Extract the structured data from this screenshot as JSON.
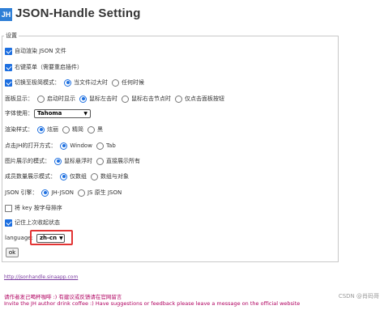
{
  "header": {
    "logo": "JH",
    "title": "JSON-Handle Setting"
  },
  "settings": {
    "legend": "设置",
    "auto_render": {
      "label": "自动渲染 JSON 文件",
      "checked": true
    },
    "context_menu": {
      "label": "右键菜单（需要重启插件）",
      "checked": true
    },
    "switch_mode": {
      "label": "切换至极简模式：",
      "checked": true,
      "options": [
        "当文件过大时",
        "任何时候"
      ],
      "selected": 0
    },
    "panel_display": {
      "label": "面板显示：",
      "options": [
        "启动时显示",
        "鼠标左击时",
        "鼠标右击节点时",
        "仅点击面板按钮"
      ],
      "selected": 1
    },
    "font": {
      "label": "字体使用：",
      "value": "Tahoma"
    },
    "render_style": {
      "label": "渲染样式：",
      "options": [
        "炫丽",
        "精简",
        "黑"
      ],
      "selected": 0
    },
    "open_mode": {
      "label": "点击JH的打开方式：",
      "options": [
        "Window",
        "Tab"
      ],
      "selected": 0
    },
    "image_mode": {
      "label": "图片展示的模式：",
      "options": [
        "鼠标悬浮时",
        "直接展示所有"
      ],
      "selected": 0
    },
    "member_count_mode": {
      "label": "成员数量展示模式：",
      "options": [
        "仅数组",
        "数组与对象"
      ],
      "selected": 0
    },
    "json_engine": {
      "label": "JSON 引擎：",
      "options": [
        "JH-JSON",
        "JS 原生 JSON"
      ],
      "selected": 0
    },
    "sort_keys": {
      "label": "将 key 按字母排序",
      "checked": false
    },
    "remember_collapse": {
      "label": "记住上次收起状态",
      "checked": true
    },
    "language": {
      "label": "language:",
      "value": "zh-cn"
    },
    "ok_label": "ok"
  },
  "footer": {
    "link": "http://jsonhandle.sinaapp.com",
    "cn_message": "请作者发己喝杯咖啡 :) 有建议或反馈请在官网留言",
    "en_message": "Invite the JH author drink coffee :) Have suggestions or feedback please leave a message on the official website",
    "watermark": "CSDN @肖码哥"
  },
  "colors": {
    "accent": "#1d6fe0",
    "highlight": "#e23434",
    "logo_bg": "#2f7fd6",
    "footer_text": "#b00060"
  }
}
